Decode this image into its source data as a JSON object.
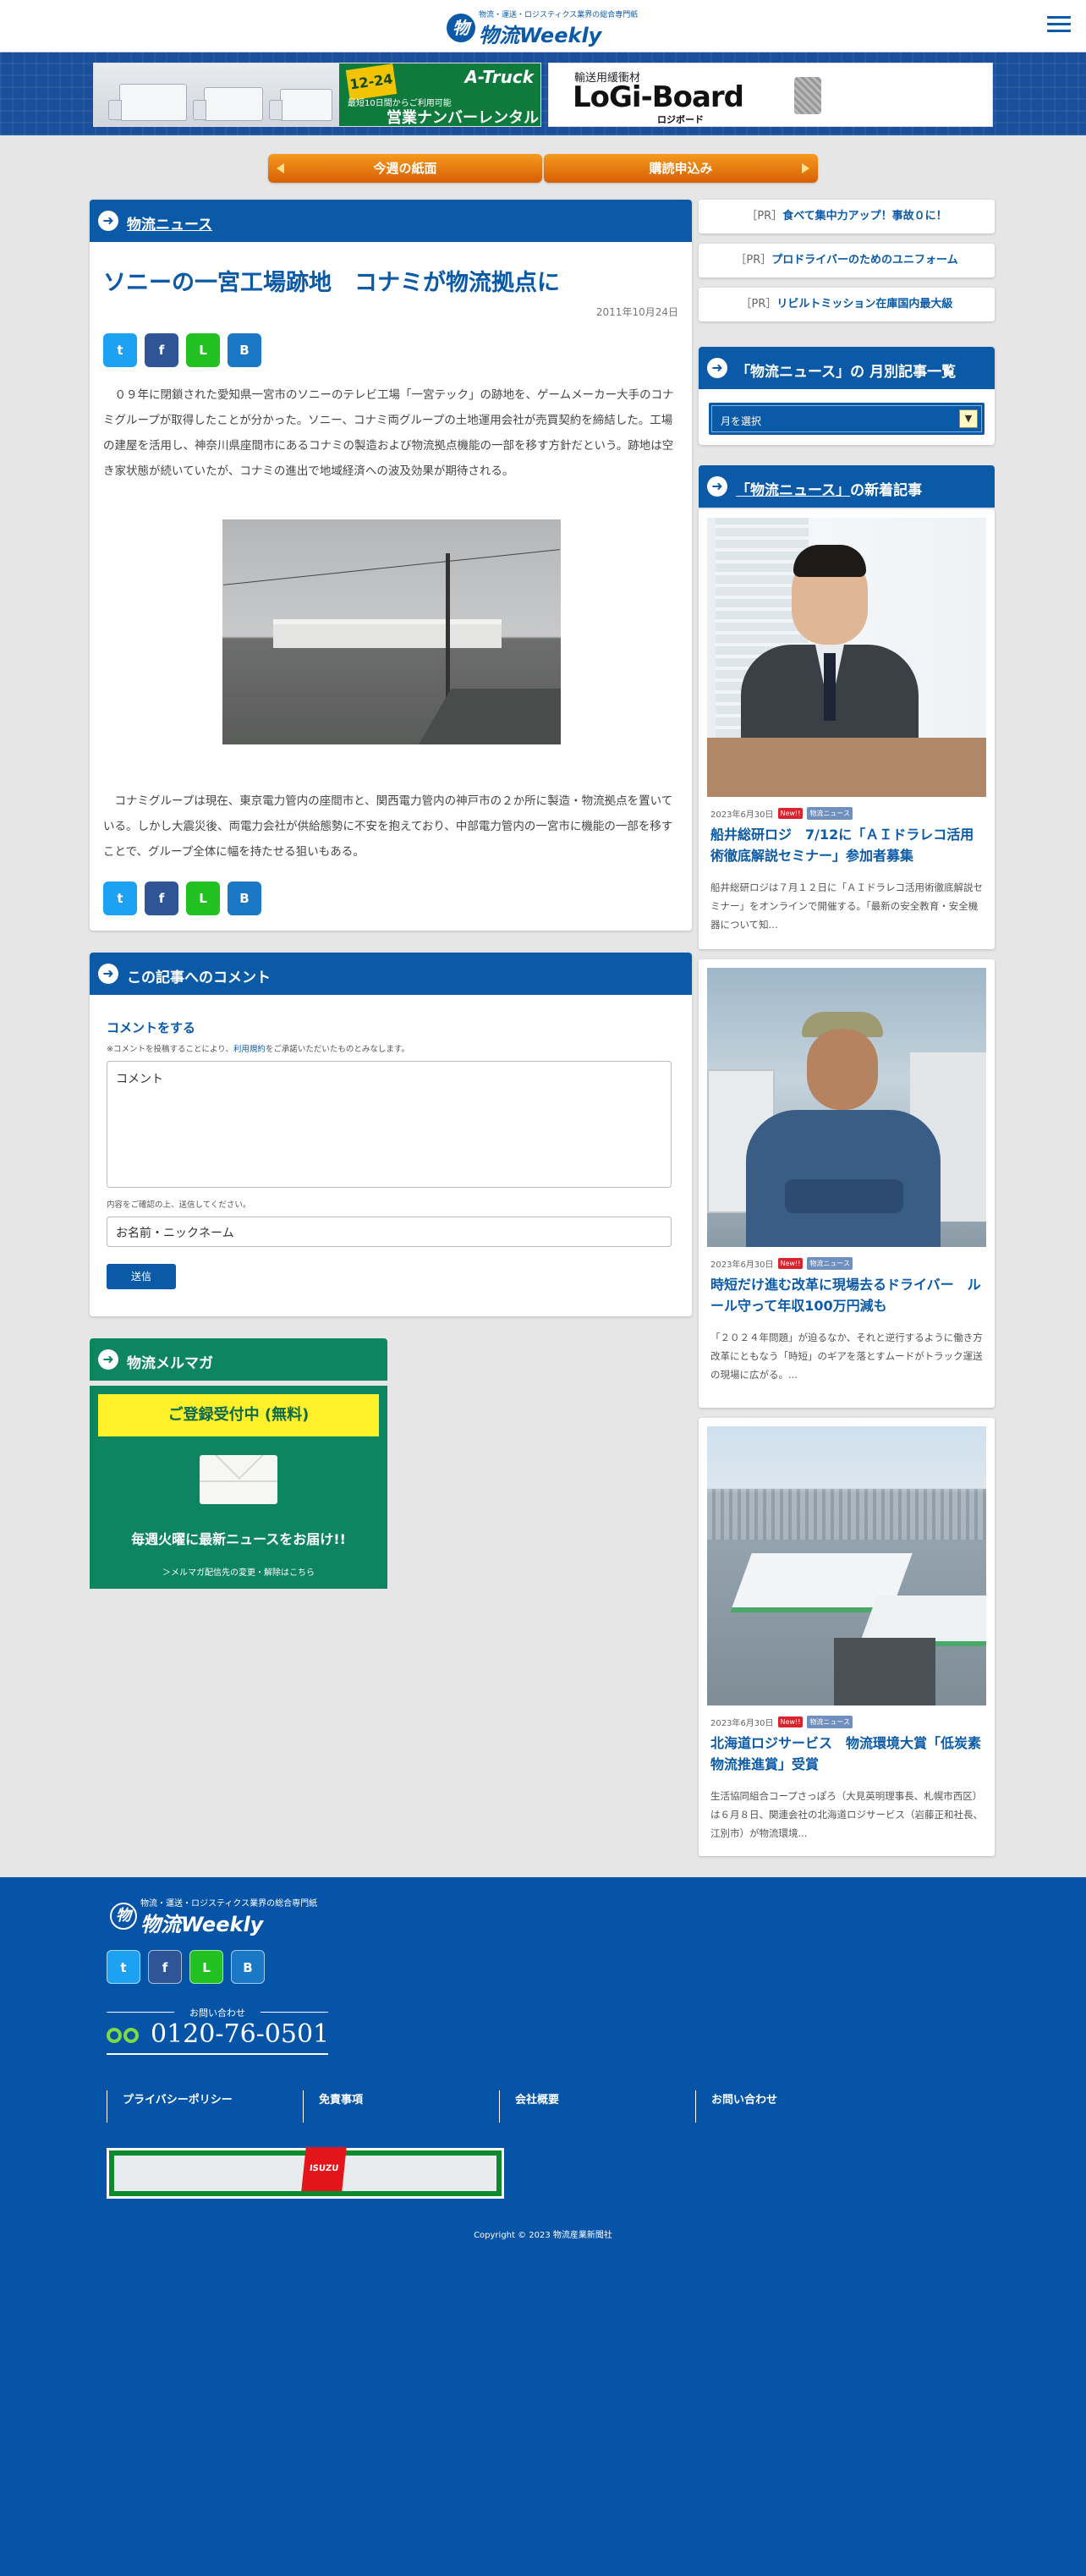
{
  "header": {
    "tagline": "物流・運送・ロジスティクス業界の総合専門紙",
    "logo_mark": "物",
    "logo_text": "物流Weekly"
  },
  "banners": {
    "ad1": {
      "date_badge": "12-24",
      "brand": "A-Truck",
      "promo": "最短10日間からご利用可能",
      "headline": "営業ナンバーレンタル"
    },
    "ad2": {
      "kicker": "輸送用緩衝材",
      "brand": "LoGi-Board",
      "sub": "ロジボード"
    }
  },
  "nav": {
    "paper_label": "今週の紙面",
    "subscribe_label": "購読申込み"
  },
  "article": {
    "section": "物流ニュース",
    "title": "ソニーの一宮工場跡地　コナミが物流拠点に",
    "date": "2011年10月24日",
    "paragraph1": "　０９年に閉鎖された愛知県一宮市のソニーのテレビ工場「一宮テック」の跡地を、ゲームメーカー大手のコナミグループが取得したことが分かった。ソニー、コナミ両グループの土地運用会社が売買契約を締結した。工場の建屋を活用し、神奈川県座間市にあるコナミの製造および物流拠点機能の一部を移す方針だという。跡地は空き家状態が続いていたが、コナミの進出で地域経済への波及効果が期待される。",
    "paragraph2": "　コナミグループは現在、東京電力管内の座間市と、関西電力管内の神戸市の２か所に製造・物流拠点を置いている。しかし大震災後、両電力会社が供給態勢に不安を抱えており、中部電力管内の一宮市に機能の一部を移すことで、グループ全体に幅を持たせる狙いもある。"
  },
  "share": {
    "twitter": "t",
    "facebook": "f",
    "line": "L",
    "hatena": "B"
  },
  "comments": {
    "section": "この記事へのコメント",
    "heading": "コメントをする",
    "note_prefix": "※コメントを投稿することにより、",
    "note_link": "利用規約",
    "note_suffix": "をご承諾いただいたものとみなします。",
    "textarea_placeholder": "コメント",
    "confirm_note": "内容をご確認の上、送信してください。",
    "name_placeholder": "お名前・ニックネーム",
    "submit_label": "送信"
  },
  "mailmag": {
    "section": "物流メルマガ",
    "register": "ご登録受付中 (無料)",
    "weekly": "毎週火曜に最新ニュースをお届け!!",
    "change": "＞メルマガ配信先の変更・解除はこちら"
  },
  "sidebar": {
    "pr_items": [
      {
        "tag": "［PR］",
        "text": "食べて集中力アップ！事故０に！"
      },
      {
        "tag": "［PR］",
        "text": "プロドライバーのためのユニフォーム"
      },
      {
        "tag": "［PR］",
        "text": "リビルトミッション在庫国内最大級"
      }
    ],
    "archive_title_pre": "「物流ニュース」の",
    "archive_title_post": " 月別記事一覧",
    "archive_select": "月を選択",
    "latest_title_pre": "「物流ニュース」",
    "latest_title_post": "の新着記事",
    "new_badge": "New!!",
    "category_badge": "物流ニュース",
    "news": [
      {
        "date": "2023年6月30日",
        "title": "船井総研ロジ　7/12に「ＡＩドラレコ活用術徹底解説セミナー」参加者募集",
        "excerpt": "船井総研ロジは７月１２日に「ＡＩドラレコ活用術徹底解説セミナー」をオンラインで開催する。「最新の安全教育・安全機器について知..."
      },
      {
        "date": "2023年6月30日",
        "title": "時短だけ進む改革に現場去るドライバー　ルール守って年収100万円減も",
        "excerpt": "「２０２４年問題」が迫るなか、それと逆行するように働き方改革にともなう「時短」のギアを落とすムードがトラック運送の現場に広がる。..."
      },
      {
        "date": "2023年6月30日",
        "title": "北海道ロジサービス　物流環境大賞「低炭素物流推進賞」受賞",
        "excerpt": "生活協同組合コープさっぽろ（大見英明理事長、札幌市西区）は６月８日、関連会社の北海道ロジサービス（岩藤正和社長、江別市）が物流環境..."
      }
    ]
  },
  "footer": {
    "tagline": "物流・運送・ロジスティクス業界の総合専門紙",
    "logo_text": "物流Weekly",
    "contact_label": "お問い合わせ",
    "phone": "0120-76-0501",
    "links": [
      "プライバシーポリシー",
      "免責事項",
      "会社概要",
      "お問い合わせ"
    ],
    "isuzu_badge": "ISUZU",
    "copyright": "Copyright © 2023 物流産業新聞社"
  },
  "colors": {
    "brand_blue": "#0b5aa8",
    "mail_green": "#0c8560",
    "nav_orange": "#f07d0c",
    "footer_blue": "#0654a8"
  }
}
